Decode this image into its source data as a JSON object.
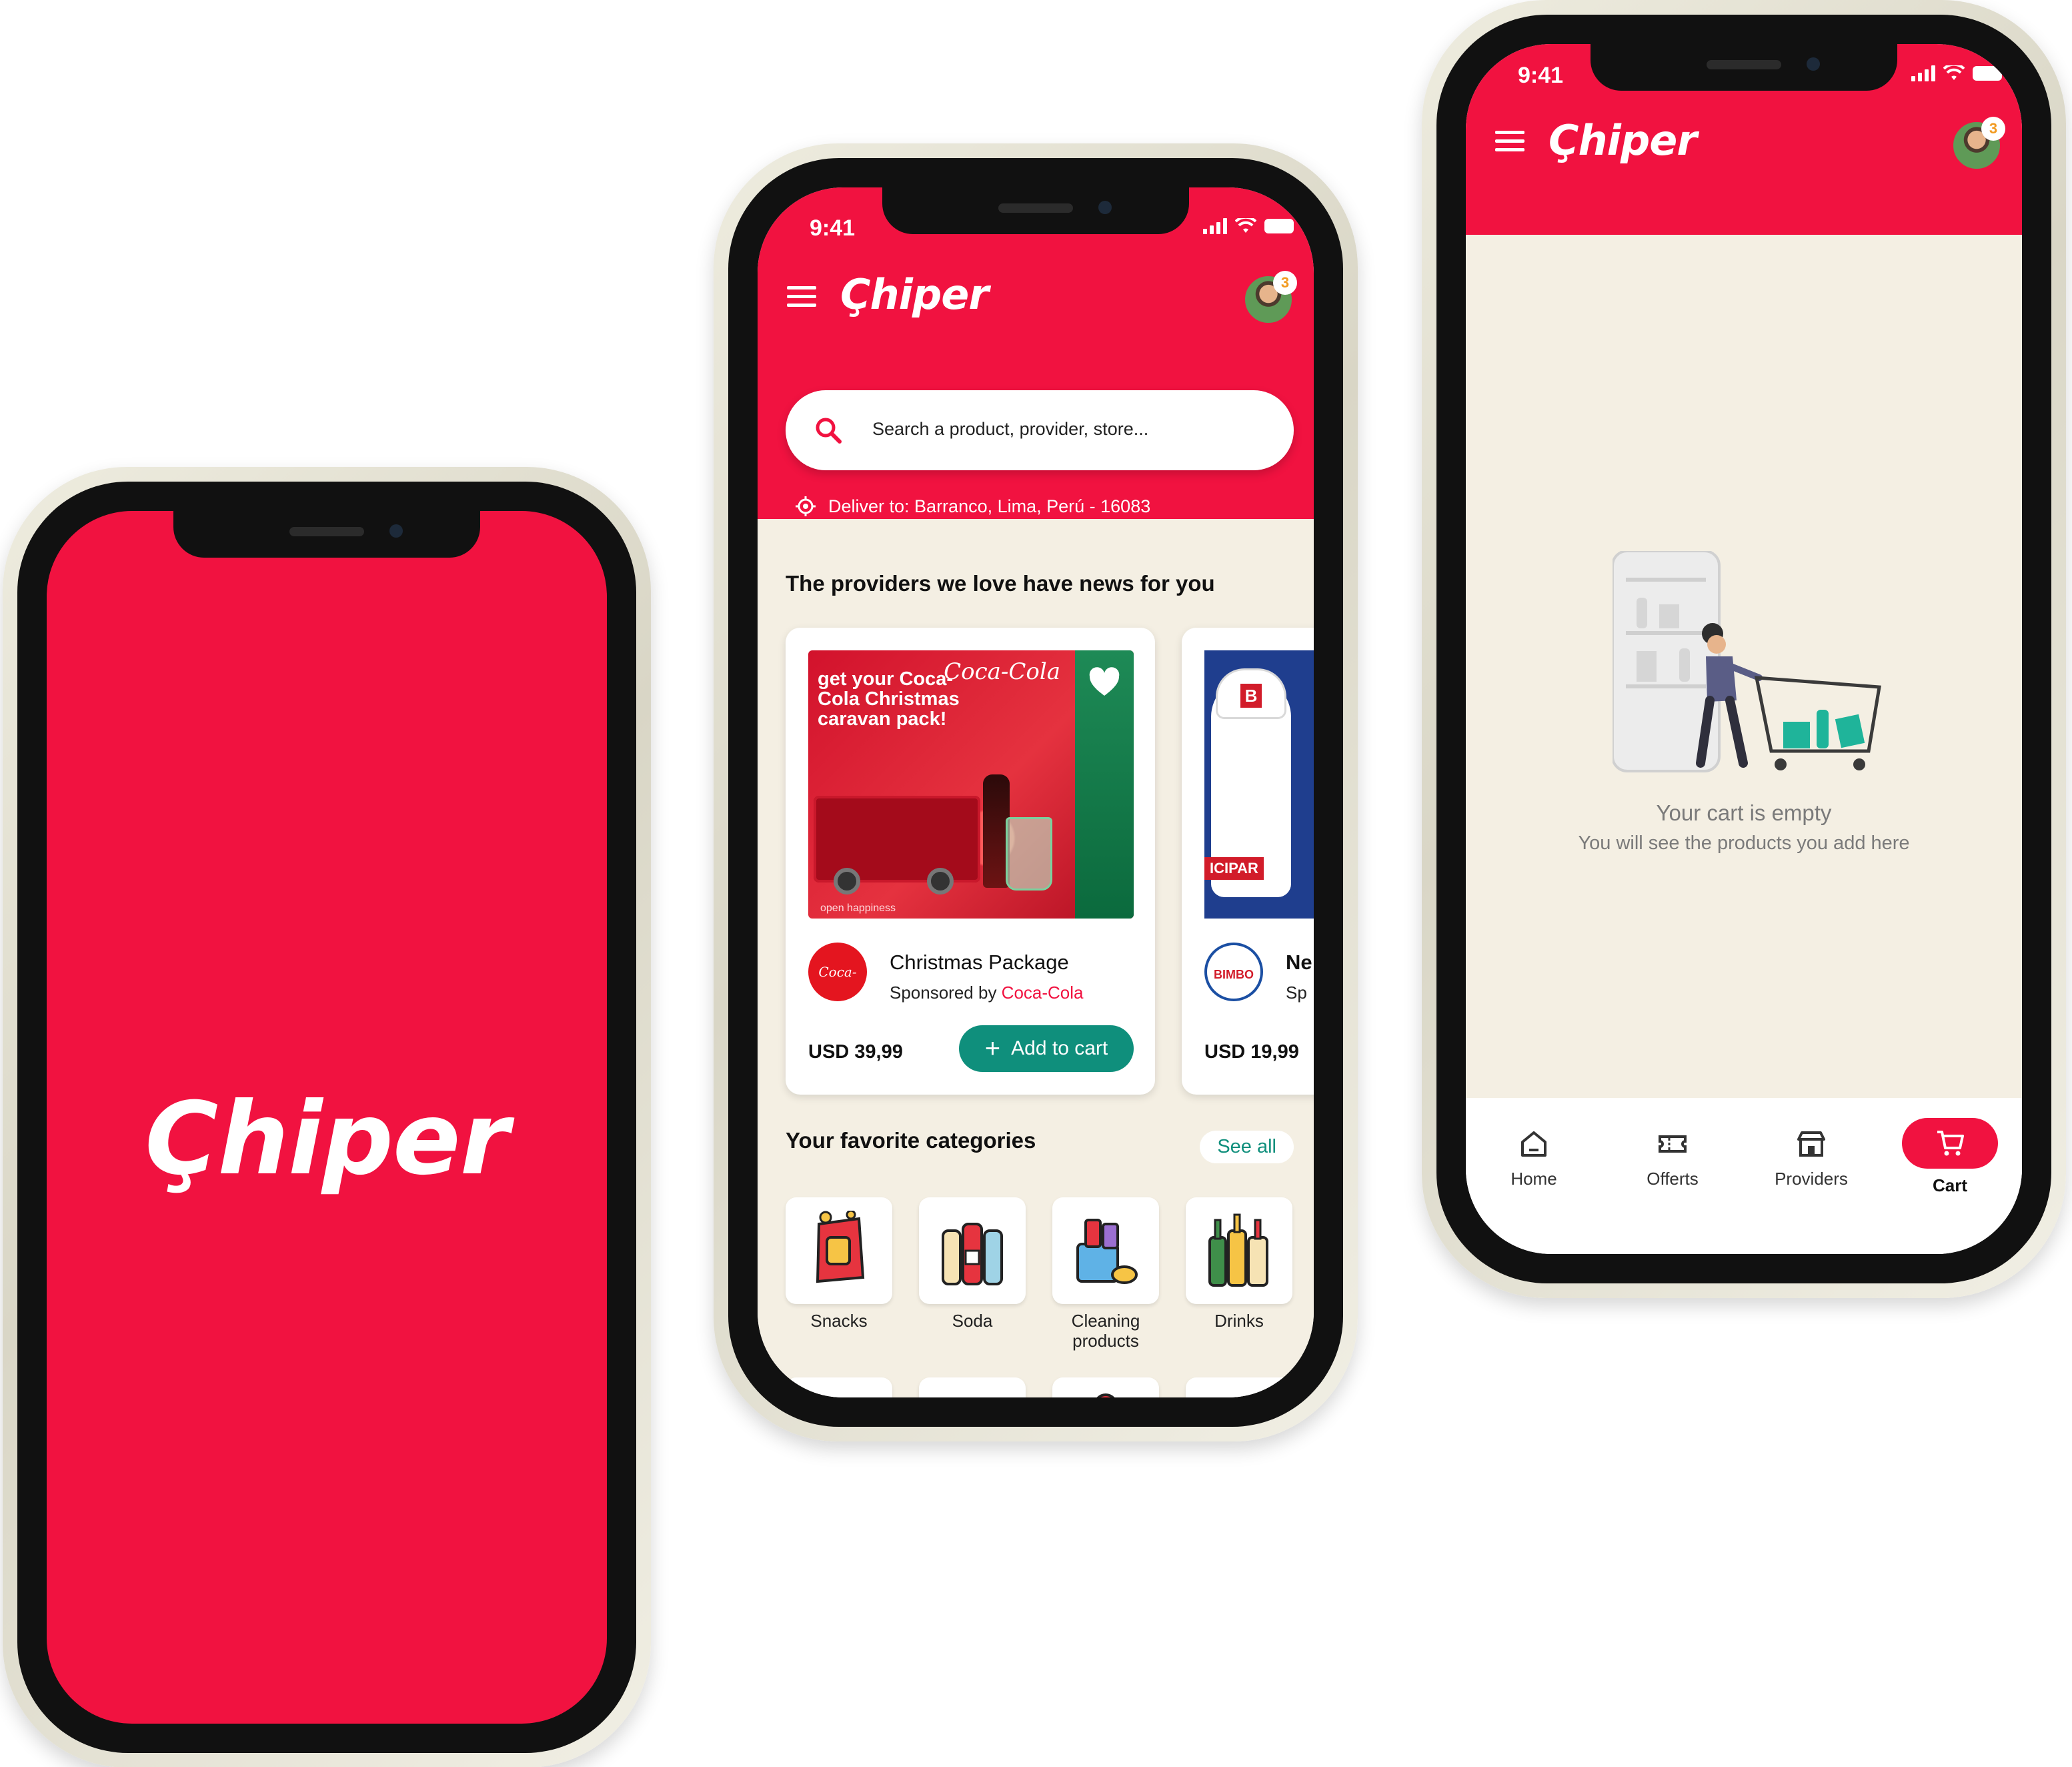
{
  "brand": {
    "logo_text": "Çhiper",
    "primary_color": "#f11240",
    "accent_color": "#0f8f7c",
    "background_color": "#f4efe3"
  },
  "status_bar": {
    "time": "9:41"
  },
  "header": {
    "notification_count": "3"
  },
  "home": {
    "search_placeholder": "Search a product, provider, store...",
    "deliver_to": "Deliver to: Barranco, Lima, Perú - 16083",
    "providers_title": "The providers we love have news for you",
    "cards": [
      {
        "promo_headline": "get your Coca-Cola Christmas caravan pack!",
        "promo_logo": "Coca-Cola",
        "promo_footer": "open happiness",
        "brand_logo": "Coca-Cola",
        "title": "Christmas Package",
        "sponsored_prefix": "Sponsored by ",
        "sponsor": "Coca-Cola",
        "price": "USD 39,99",
        "add_button": "Add to cart"
      },
      {
        "promo_tag": "ICIPAR",
        "brand_logo": "BIMBO",
        "title": "Ne",
        "sponsored_prefix": "Sp",
        "price": "USD 19,99"
      }
    ],
    "categories_title": "Your favorite categories",
    "see_all": "See all",
    "categories": [
      {
        "label": "Snacks",
        "icon": "snacks-icon"
      },
      {
        "label": "Soda",
        "icon": "soda-icon"
      },
      {
        "label": "Cleaning products",
        "icon": "cleaning-icon"
      },
      {
        "label": "Drinks",
        "icon": "drinks-icon"
      },
      {
        "label": "",
        "icon": "meat-icon"
      },
      {
        "label": "",
        "icon": "vegetables-icon"
      },
      {
        "label": "",
        "icon": "pharmacy-icon"
      },
      {
        "label": "",
        "icon": "furniture-icon"
      }
    ]
  },
  "cart": {
    "empty_title": "Your cart is empty",
    "empty_subtitle": "You will see the products you add here"
  },
  "tabbar": {
    "tabs": [
      {
        "label": "Home",
        "icon": "home-icon"
      },
      {
        "label": "Offerts",
        "icon": "ticket-icon"
      },
      {
        "label": "Providers",
        "icon": "store-icon"
      },
      {
        "label": "Cart",
        "icon": "cart-icon",
        "active": true
      }
    ]
  }
}
